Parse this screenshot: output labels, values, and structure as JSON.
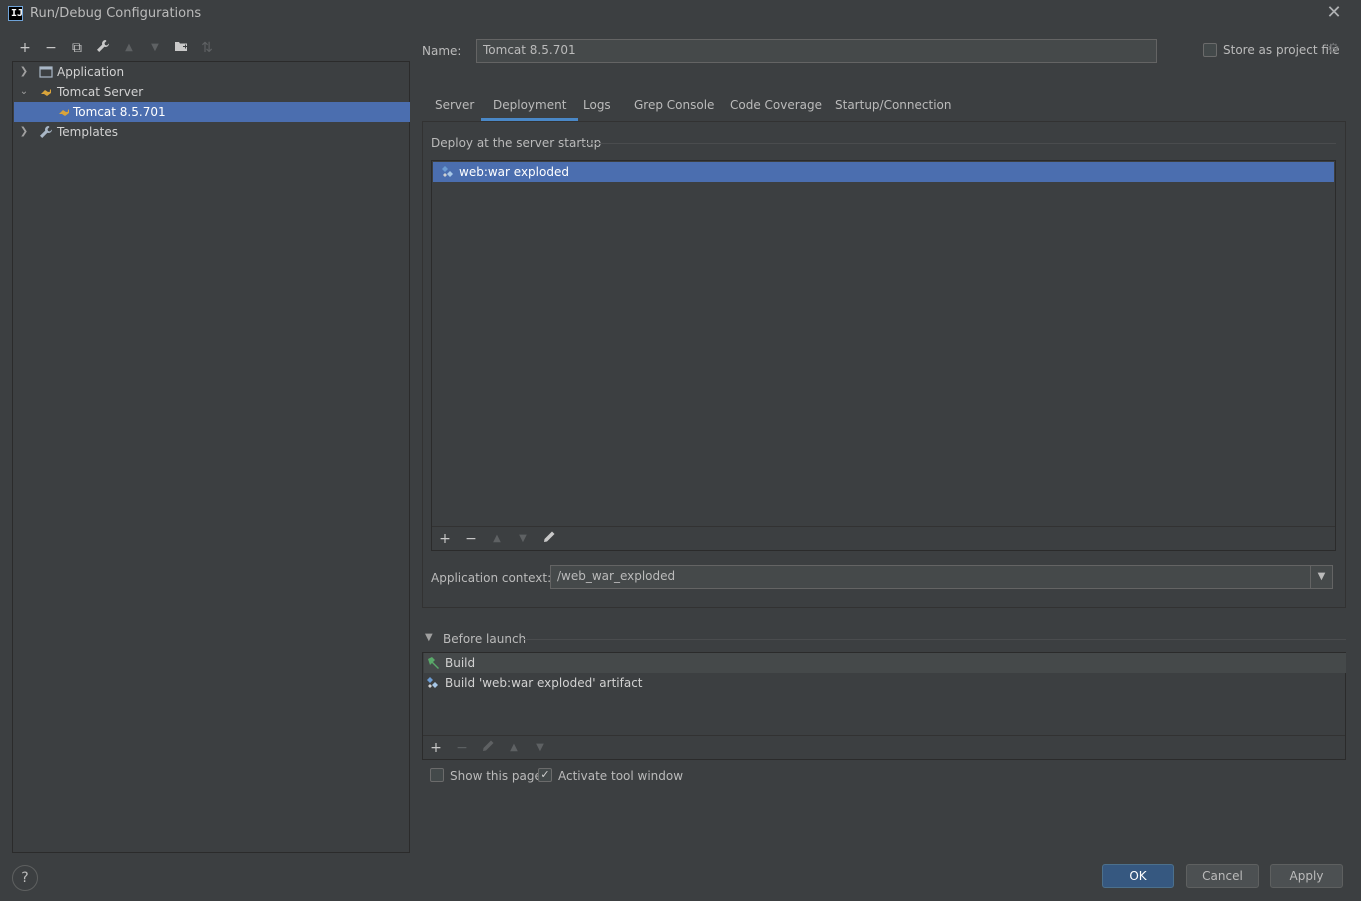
{
  "window": {
    "title": "Run/Debug Configurations",
    "logo_text": "IJ"
  },
  "toolbar": {
    "add": "+",
    "remove": "−",
    "copy": "⧉",
    "wrench": "🔧",
    "up": "▲",
    "down": "▼",
    "folder": "▆",
    "sort": "⇅"
  },
  "tree": {
    "items": [
      {
        "label": "Application"
      },
      {
        "label": "Tomcat Server"
      },
      {
        "label": "Tomcat 8.5.701"
      },
      {
        "label": "Templates"
      }
    ]
  },
  "name_field": {
    "label": "Name:",
    "value": "Tomcat 8.5.701"
  },
  "store_as_project_file": {
    "label": "Store as project file",
    "checked": false
  },
  "tabs": [
    {
      "label": "Server"
    },
    {
      "label": "Deployment"
    },
    {
      "label": "Logs"
    },
    {
      "label": "Grep Console"
    },
    {
      "label": "Code Coverage"
    },
    {
      "label": "Startup/Connection"
    }
  ],
  "deployment": {
    "group_label": "Deploy at the server startup",
    "items": [
      {
        "label": "web:war exploded"
      }
    ],
    "app_context_label": "Application context:",
    "app_context_value": "/web_war_exploded"
  },
  "before_launch": {
    "label": "Before launch",
    "items": [
      {
        "label": "Build"
      },
      {
        "label": "Build 'web:war exploded' artifact"
      }
    ]
  },
  "options": {
    "show_this_page": {
      "label": "Show this page",
      "checked": false
    },
    "activate_tool_window": {
      "label": "Activate tool window",
      "checked": true
    }
  },
  "buttons": {
    "help": "?",
    "ok": "OK",
    "cancel": "Cancel",
    "apply": "Apply"
  },
  "colors": {
    "background": "#3c3f41",
    "selection": "#4b6eaf",
    "primary_button": "#365880",
    "active_tab_underline": "#4a88c7"
  }
}
